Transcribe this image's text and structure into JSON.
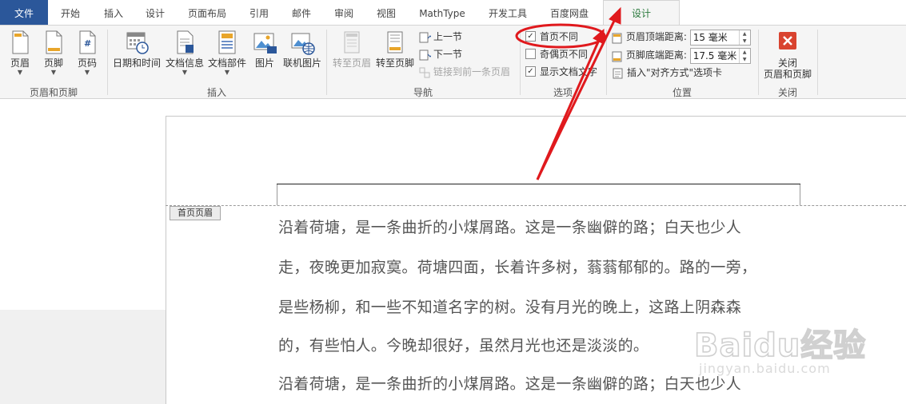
{
  "tabs": [
    "文件",
    "开始",
    "插入",
    "设计",
    "页面布局",
    "引用",
    "邮件",
    "审阅",
    "视图",
    "MathType",
    "开发工具",
    "百度网盘",
    "设计"
  ],
  "active_tab_index": 12,
  "ribbon": {
    "header_footer_group": {
      "label": "页眉和页脚",
      "buttons": [
        "页眉",
        "页脚",
        "页码"
      ]
    },
    "insert_group": {
      "label": "插入",
      "buttons": [
        "日期和时间",
        "文档信息",
        "文档部件",
        "图片",
        "联机图片"
      ]
    },
    "navigation_group": {
      "label": "导航",
      "goto_header": "转至页眉",
      "goto_footer": "转至页脚",
      "prev_section": "上一节",
      "next_section": "下一节",
      "link_to_previous": "链接到前一条页眉"
    },
    "options_group": {
      "label": "选项",
      "different_first_page": "首页不同",
      "different_first_page_checked": true,
      "different_odd_even": "奇偶页不同",
      "different_odd_even_checked": false,
      "show_doc_text": "显示文档文字",
      "show_doc_text_checked": true
    },
    "position_group": {
      "label": "位置",
      "header_from_top_label": "页眉顶端距离:",
      "header_from_top_value": "15 毫米",
      "footer_from_bottom_label": "页脚底端距离:",
      "footer_from_bottom_value": "17.5 毫米",
      "insert_alignment_tab": "插入\"对齐方式\"选项卡"
    },
    "close_group": {
      "label": "关闭",
      "close_button": "关闭\n页眉和页脚"
    }
  },
  "document": {
    "header_tag": "首页页眉",
    "paragraphs": [
      "沿着荷塘，是一条曲折的小煤屑路。这是一条幽僻的路；白天也少人",
      "走，夜晚更加寂寞。荷塘四面，长着许多树，蓊蓊郁郁的。路的一旁，",
      "是些杨柳，和一些不知道名字的树。没有月光的晚上，这路上阴森森",
      "的，有些怕人。今晚却很好，虽然月光也还是淡淡的。",
      "沿着荷塘，是一条曲折的小煤屑路。这是一条幽僻的路；白天也少人"
    ]
  },
  "watermark": {
    "main": "Baidu经验",
    "sub": "jingyan.baidu.com"
  },
  "colors": {
    "file_tab": "#2b579a",
    "active_tab_text": "#2b7a3d",
    "annotation_red": "#e0191d",
    "close_icon": "#d9432f"
  }
}
